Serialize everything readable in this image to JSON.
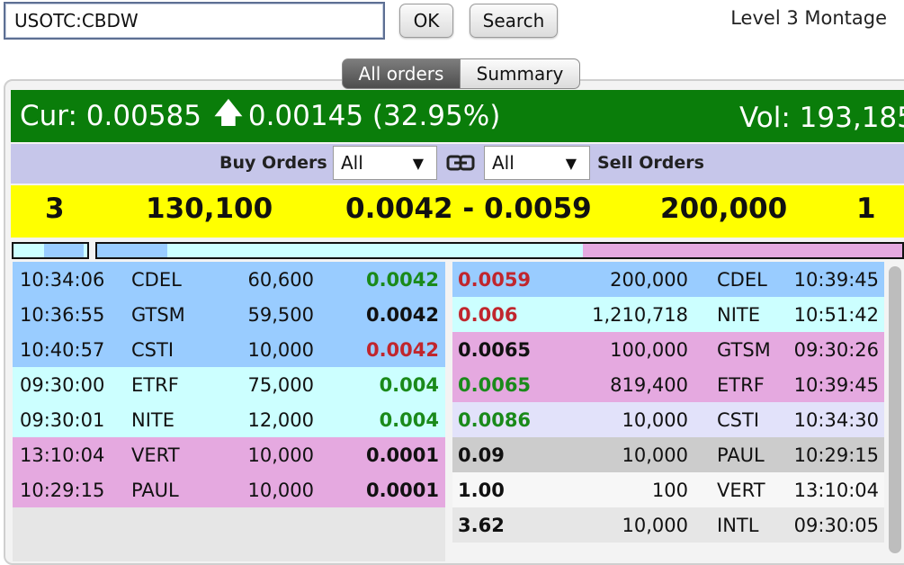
{
  "topbar": {
    "symbol_value": "USOTC:CBDW",
    "ok_label": "OK",
    "search_label": "Search",
    "title": "Level 3 Montage"
  },
  "tabs": [
    {
      "label": "All orders",
      "active": true
    },
    {
      "label": "Summary",
      "active": false
    }
  ],
  "quote": {
    "cur_label": "Cur: 0.00585",
    "arrow": "🡅",
    "change": "0.00145 (32.95%)",
    "vol_label": "Vol: 193,185"
  },
  "filters": {
    "buy_label": "Buy Orders",
    "buy_value": "All",
    "sell_label": "Sell Orders",
    "sell_value": "All",
    "caret": "▼"
  },
  "summary": {
    "bid_count": "3",
    "bid_size": "130,100",
    "spread": "0.0042 - 0.0059",
    "ask_size": "200,000",
    "ask_count": "1"
  },
  "colors": {
    "header_green": "#0a7d0a",
    "summary_yellow": "#ffff00",
    "level_blue": "#99ccff",
    "level_cyan": "#ccffff",
    "level_pink": "#e5a9e0",
    "level_lavender": "#e2e2fa",
    "level_gray": "#cccccc"
  },
  "buy_orders": [
    {
      "time": "10:34:06",
      "mmid": "CDEL",
      "size": "60,600",
      "price": "0.0042",
      "price_color": "green"
    },
    {
      "time": "10:36:55",
      "mmid": "GTSM",
      "size": "59,500",
      "price": "0.0042",
      "price_color": "black"
    },
    {
      "time": "10:40:57",
      "mmid": "CSTI",
      "size": "10,000",
      "price": "0.0042",
      "price_color": "red"
    },
    {
      "time": "09:30:00",
      "mmid": "ETRF",
      "size": "75,000",
      "price": "0.004",
      "price_color": "green"
    },
    {
      "time": "09:30:01",
      "mmid": "NITE",
      "size": "12,000",
      "price": "0.004",
      "price_color": "green"
    },
    {
      "time": "13:10:04",
      "mmid": "VERT",
      "size": "10,000",
      "price": "0.0001",
      "price_color": "black"
    },
    {
      "time": "10:29:15",
      "mmid": "PAUL",
      "size": "10,000",
      "price": "0.0001",
      "price_color": "black"
    }
  ],
  "sell_orders": [
    {
      "price": "0.0059",
      "size": "200,000",
      "mmid": "CDEL",
      "time": "10:39:45",
      "price_color": "red"
    },
    {
      "price": "0.006",
      "size": "1,210,718",
      "mmid": "NITE",
      "time": "10:51:42",
      "price_color": "red"
    },
    {
      "price": "0.0065",
      "size": "100,000",
      "mmid": "GTSM",
      "time": "09:30:26",
      "price_color": "black"
    },
    {
      "price": "0.0065",
      "size": "819,400",
      "mmid": "ETRF",
      "time": "10:39:45",
      "price_color": "green"
    },
    {
      "price": "0.0086",
      "size": "10,000",
      "mmid": "CSTI",
      "time": "10:34:30",
      "price_color": "green"
    },
    {
      "price": "0.09",
      "size": "10,000",
      "mmid": "PAUL",
      "time": "10:29:15",
      "price_color": "black"
    },
    {
      "price": "1.00",
      "size": "100",
      "mmid": "VERT",
      "time": "13:10:04",
      "price_color": "black"
    },
    {
      "price": "3.62",
      "size": "10,000",
      "mmid": "INTL",
      "time": "09:30:05",
      "price_color": "black"
    }
  ]
}
